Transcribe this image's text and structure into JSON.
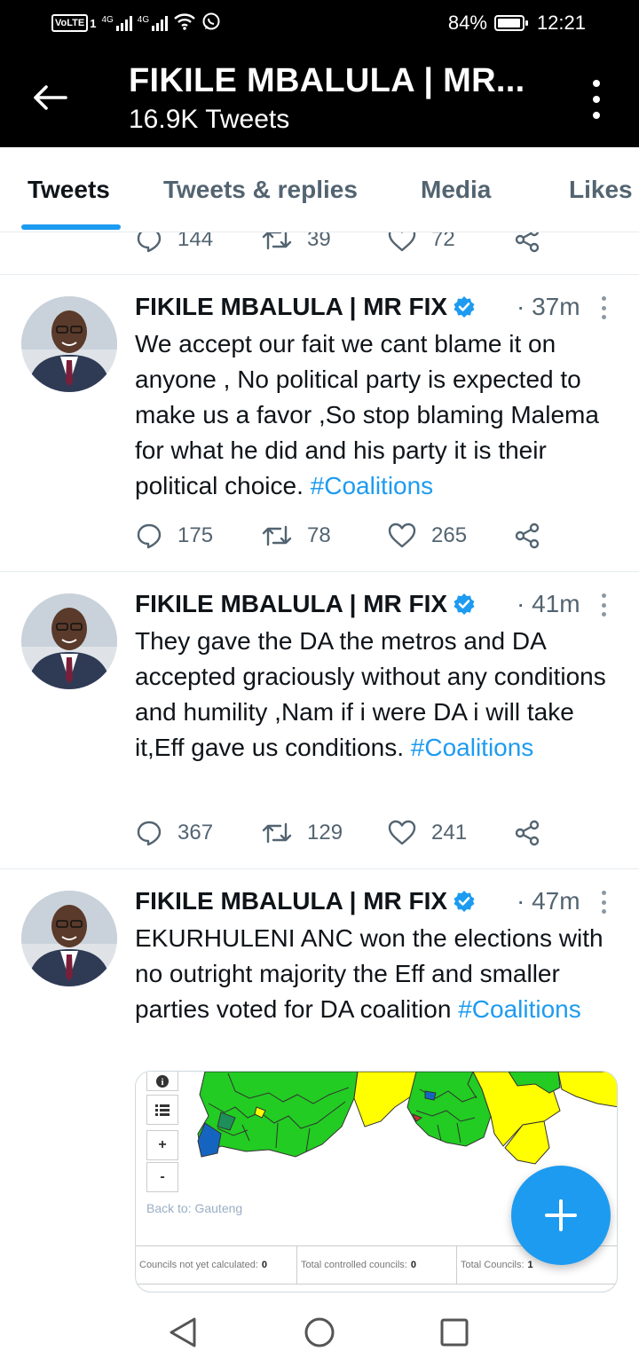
{
  "status_bar": {
    "volte": "VoLTE",
    "sim1": "1",
    "net1": "4G",
    "net2": "4G",
    "battery_text": "84%",
    "battery_level": 0.84,
    "time": "12:21",
    "icons": [
      "wifi-icon",
      "whatsapp-icon"
    ]
  },
  "header": {
    "title": "FIKILE MBALULA | MR...",
    "subtitle": "16.9K Tweets"
  },
  "tabs": [
    {
      "label": "Tweets",
      "active": true
    },
    {
      "label": "Tweets & replies",
      "active": false
    },
    {
      "label": "Media",
      "active": false
    },
    {
      "label": "Likes",
      "active": false
    }
  ],
  "partial_tweet": {
    "replies": "144",
    "retweets": "39",
    "likes": "72"
  },
  "tweets": [
    {
      "author": "FIKILE MBALULA | MR FIX",
      "time": "· 37m",
      "text": "We accept our fait we cant blame it on anyone  , No political party is expected to make us a favor ,So stop blaming Malema for what he did and his party it is their political choice. ",
      "hashtag": "#Coalitions",
      "replies": "175",
      "retweets": "78",
      "likes": "265"
    },
    {
      "author": "FIKILE MBALULA | MR FIX",
      "time": "· 41m",
      "text": "They gave the DA the metros and DA accepted graciously without any conditions and humility ,Nam if i were DA i will take it,Eff gave us conditions. ",
      "hashtag": "#Coalitions",
      "replies": "367",
      "retweets": "129",
      "likes": "241"
    },
    {
      "author": "FIKILE MBALULA | MR FIX",
      "time": "· 47m",
      "text": "EKURHULENI ANC won the elections with no outright majority the Eff and smaller parties voted for DA coalition ",
      "hashtag": "#Coalitions"
    }
  ],
  "media": {
    "back_to": "Back to: Gauteng",
    "zoom_in": "+",
    "zoom_out": "-",
    "info": "i",
    "cells": [
      {
        "label": "Councils not yet calculated:",
        "value": "0"
      },
      {
        "label": "Total controlled councils:",
        "value": "0"
      },
      {
        "label": "Total Councils:",
        "value": "1"
      }
    ],
    "colors": {
      "anc": "#22cc22",
      "da": "#1565c0",
      "eff": "#d32f2f",
      "other": "#ffff00"
    }
  },
  "colors": {
    "accent": "#1d9bf0",
    "header_bg": "#000000",
    "muted": "#536471"
  }
}
